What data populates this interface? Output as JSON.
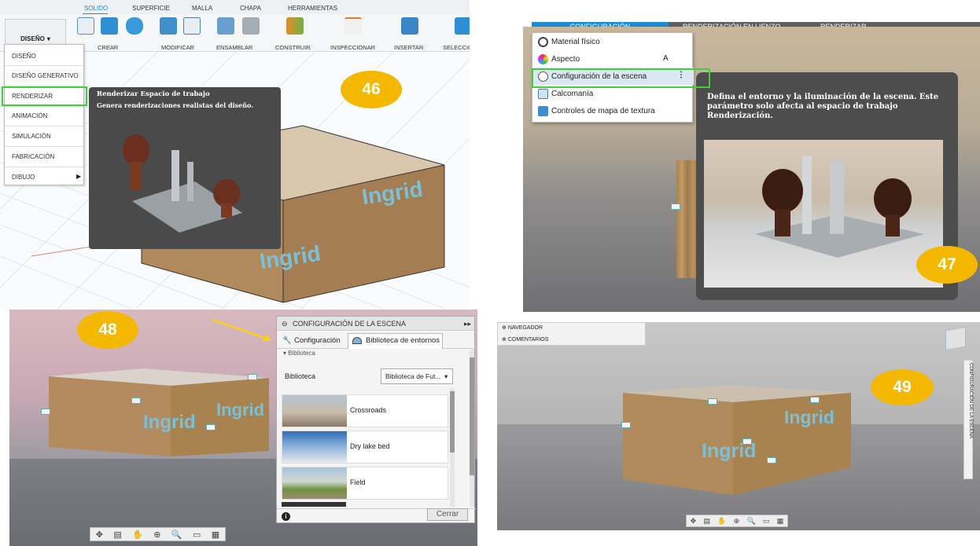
{
  "panel46": {
    "tabs": [
      "SOLIDO",
      "SUPERFICIE",
      "MALLA",
      "CHAPA",
      "HERRAMIENTAS"
    ],
    "workspace_button": "DISEÑO",
    "groups": [
      "CREAR",
      "MODIFICAR",
      "ENSAMBLAR",
      "CONSTRUIR",
      "INSPECCIONAR",
      "INSERTAR",
      "SELECCIO"
    ],
    "menu_items": [
      "DISEÑO",
      "DISEÑO GENERATIVO",
      "RENDERIZAR",
      "ANIMACIÓN",
      "SIMULACIÓN",
      "FABRICACIÓN",
      "DIBUJO"
    ],
    "tooltip_title": "Renderizar Espacio de trabajo",
    "tooltip_body": "Genera renderizaciones realistas del diseño.",
    "badge": "46",
    "box_label": "Ingrid"
  },
  "panel47": {
    "top_tabs": [
      "CONFIGURACIÓN",
      "RENDERIZACIÓN EN LIENZO",
      "RENDERIZAR"
    ],
    "context_items": [
      {
        "label": "Material físico",
        "shortcut": ""
      },
      {
        "label": "Aspecto",
        "shortcut": "A"
      },
      {
        "label": "Configuración de la escena",
        "shortcut": "⋮"
      },
      {
        "label": "Calcomanía",
        "shortcut": ""
      },
      {
        "label": "Controles de mapa de textura",
        "shortcut": ""
      }
    ],
    "tooltip_text": "Defina el entorno y la iluminación de la escena. Este parámetro solo afecta al espacio de trabajo Renderización.",
    "badge": "47"
  },
  "panel48": {
    "badge": "48",
    "dialog_title": "CONFIGURACIÓN DE LA ESCENA",
    "tab_config": "Configuración",
    "tab_library": "Biblioteca de entornos",
    "section": "Biblioteca",
    "library_label": "Biblioteca",
    "library_value": "Biblioteca de Fut...",
    "environments": [
      "Crossroads",
      "Dry lake bed",
      "Field"
    ],
    "close_button": "Cerrar",
    "box_label": "Ingrid"
  },
  "panel49": {
    "badge": "49",
    "browser_items": [
      "NAVEGADOR",
      "COMENTARIOS"
    ],
    "side_label": "CONFIGURACIÓN DE LA ESCENA",
    "box_label": "Ingrid"
  },
  "colors": {
    "badge": "#f5b800",
    "highlight": "#3fd13a",
    "accent": "#1d8ad6"
  }
}
